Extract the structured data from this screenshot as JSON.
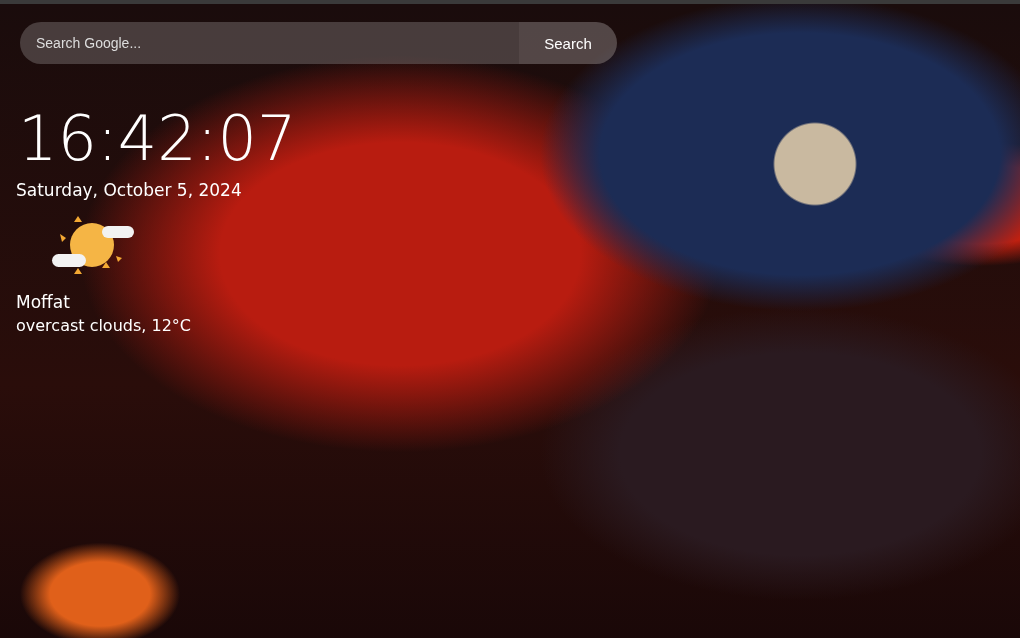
{
  "search": {
    "placeholder": "Search Google...",
    "button": "Search"
  },
  "clock": {
    "time": "16:42:07",
    "date": "Saturday, October 5, 2024"
  },
  "weather": {
    "location": "Moffat",
    "description": "overcast clouds, 12°C"
  }
}
